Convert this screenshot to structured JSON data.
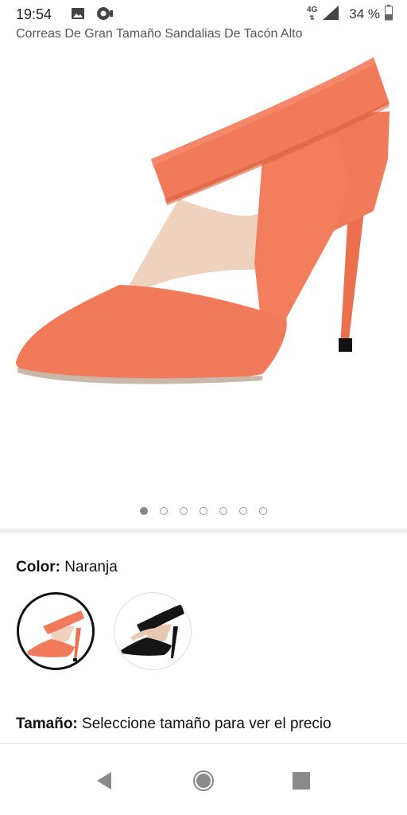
{
  "status_bar": {
    "time": "19:54",
    "network": "4G",
    "battery": "34 %",
    "left_icons": [
      "image-icon",
      "camera-notification-icon"
    ],
    "right_icons": [
      "signal-icon",
      "battery-icon"
    ]
  },
  "product": {
    "title": "Correas De Gran Tamaño Sandalias De Tacón Alto",
    "image_count": 7,
    "active_image": 1
  },
  "color": {
    "label": "Color:",
    "value": "Naranja",
    "swatches": [
      {
        "name": "Naranja",
        "color": "#f07a5a",
        "selected": true
      },
      {
        "name": "Negro",
        "color": "#151515",
        "selected": false
      }
    ]
  },
  "size": {
    "label": "Tamaño:",
    "value": "Seleccione tamaño para ver el precio"
  },
  "nav": {
    "icons": [
      "back-icon",
      "home-icon",
      "recents-icon"
    ]
  },
  "colors": {
    "shoe": "#f07a5a",
    "shoe_shadow": "#d9603f",
    "lining": "#efd2bd",
    "sole": "#111111",
    "nav_icon": "#8a8a8a"
  }
}
